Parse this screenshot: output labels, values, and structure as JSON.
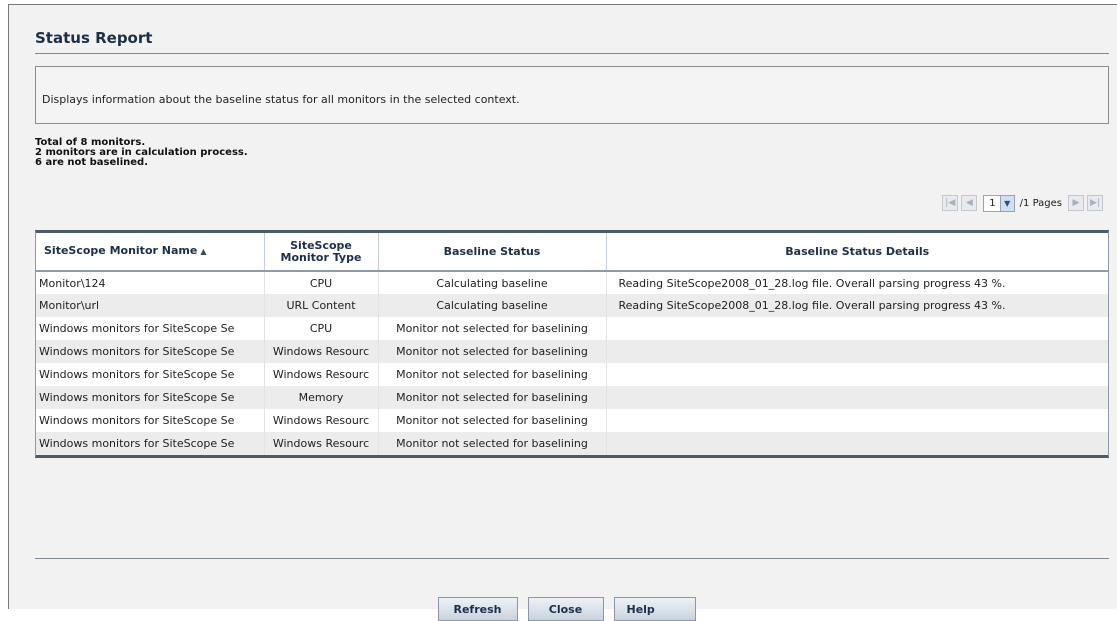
{
  "page": {
    "title": "Status Report",
    "description": "Displays information about the baseline status for all monitors in the selected context."
  },
  "summary": {
    "line1": "Total of 8 monitors.",
    "line2": "2 monitors are in calculation process.",
    "line3": "6 are not baselined."
  },
  "pager": {
    "current_page": "1",
    "pages_label": "/1 Pages"
  },
  "table": {
    "headers": {
      "name": "SiteScope Monitor Name",
      "type_line1": "SiteScope",
      "type_line2": "Monitor Type",
      "status": "Baseline Status",
      "details": "Baseline Status Details"
    },
    "rows": [
      {
        "name": "Monitor\\124",
        "type": "CPU",
        "status": "Calculating baseline",
        "details": "Reading SiteScope2008_01_28.log file. Overall parsing progress 43 %."
      },
      {
        "name": "Monitor\\url",
        "type": "URL Content",
        "status": "Calculating baseline",
        "details": "Reading SiteScope2008_01_28.log file. Overall parsing progress 43 %."
      },
      {
        "name": "Windows monitors for SiteScope Se",
        "type": "CPU",
        "status": "Monitor not selected for baselining",
        "details": ""
      },
      {
        "name": "Windows monitors for SiteScope Se",
        "type": "Windows Resourc",
        "status": "Monitor not selected for baselining",
        "details": ""
      },
      {
        "name": "Windows monitors for SiteScope Se",
        "type": "Windows Resourc",
        "status": "Monitor not selected for baselining",
        "details": ""
      },
      {
        "name": "Windows monitors for SiteScope Se",
        "type": "Memory",
        "status": "Monitor not selected for baselining",
        "details": ""
      },
      {
        "name": "Windows monitors for SiteScope Se",
        "type": "Windows Resourc",
        "status": "Monitor not selected for baselining",
        "details": ""
      },
      {
        "name": "Windows monitors for SiteScope Se",
        "type": "Windows Resourc",
        "status": "Monitor not selected for baselining",
        "details": ""
      }
    ]
  },
  "buttons": {
    "refresh": "Refresh",
    "close": "Close",
    "help": "Help"
  },
  "icons": {
    "first_page": "first-page-icon",
    "prev_page": "prev-page-icon",
    "next_page": "next-page-icon",
    "last_page": "last-page-icon",
    "dropdown": "chevron-down-icon",
    "sort": "sort-ascending-icon"
  }
}
